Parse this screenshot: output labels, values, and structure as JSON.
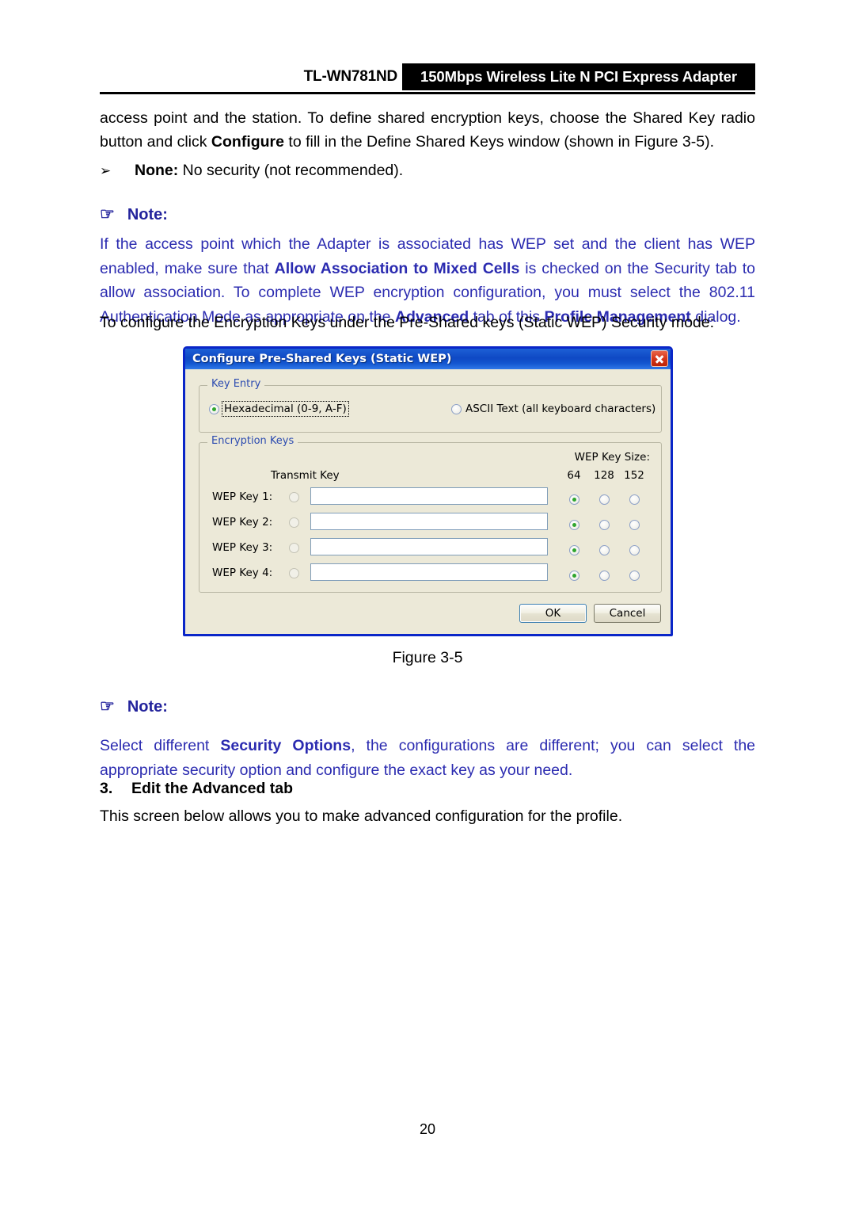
{
  "header": {
    "model": "TL-WN781ND",
    "product": "150Mbps Wireless Lite N PCI Express Adapter"
  },
  "content": {
    "intro_paragraph": "access point and the station. To define shared encryption keys, choose the Shared Key radio button and click ",
    "intro_bold": "Configure",
    "intro_paragraph_tail": " to fill in the Define Shared Keys window (shown in Figure 3-5).",
    "bullet_mark": "➢",
    "bullet_bold": "None:",
    "bullet_text": " No security (not recommended).",
    "note_label": "Note:",
    "note_hand_icon": "☞",
    "note1_t1": "If the access point which the Adapter is associated has WEP set and the client has WEP enabled, make sure that ",
    "note1_b1": "Allow Association to Mixed Cells",
    "note1_t2": " is checked on the Security tab to allow association. To complete WEP encryption configuration, you must select the 802.11 Authentication Mode as appropriate on the ",
    "note1_b2": "Advanced",
    "note1_t3": " tab of this ",
    "note1_b3": "Profile Management",
    "note1_t4": " dialog.",
    "configure_mode_line": "To configure the Encryption Keys under the Pre-Shared keys (Static WEP) Security mode:",
    "figure_caption": "Figure 3-5",
    "note2_t1": "Select different ",
    "note2_b1": "Security Options",
    "note2_t2": ", the configurations are different; you can select the appropriate security option and configure the exact key as your need.",
    "section_number": "3.",
    "section_title": "Edit the Advanced tab",
    "advanced_desc": "This screen below allows you to make advanced configuration for the profile.",
    "page_number": "20"
  },
  "dialog": {
    "title": "Configure Pre-Shared Keys (Static WEP)",
    "close_icon": "close-icon",
    "key_entry": {
      "group_label": "Key Entry",
      "hex_label": "Hexadecimal (0-9, A-F)",
      "hex_selected": true,
      "ascii_label": "ASCII Text (all keyboard characters)",
      "ascii_selected": false
    },
    "encryption_keys": {
      "group_label": "Encryption Keys",
      "wep_key_size_label": "WEP Key Size:",
      "transmit_key_label": "Transmit Key",
      "size_columns": [
        "64",
        "128",
        "152"
      ],
      "rows": [
        {
          "label": "WEP Key 1:",
          "value": "",
          "transmit": false,
          "size_selected": 0
        },
        {
          "label": "WEP Key 2:",
          "value": "",
          "transmit": false,
          "size_selected": 0
        },
        {
          "label": "WEP Key 3:",
          "value": "",
          "transmit": false,
          "size_selected": 0
        },
        {
          "label": "WEP Key 4:",
          "value": "",
          "transmit": false,
          "size_selected": 0
        }
      ]
    },
    "buttons": {
      "ok": "OK",
      "cancel": "Cancel"
    }
  },
  "colors": {
    "note_blue": "#2b2bb0",
    "note_heading_blue": "#23239c",
    "titlebar_blue": "#0f49c4",
    "dialog_face": "#ece9d8",
    "dialog_border": "#0a26c8",
    "radio_green": "#2fa62f",
    "close_red": "#d8391c",
    "groupbox_label": "#2c4bb0"
  }
}
